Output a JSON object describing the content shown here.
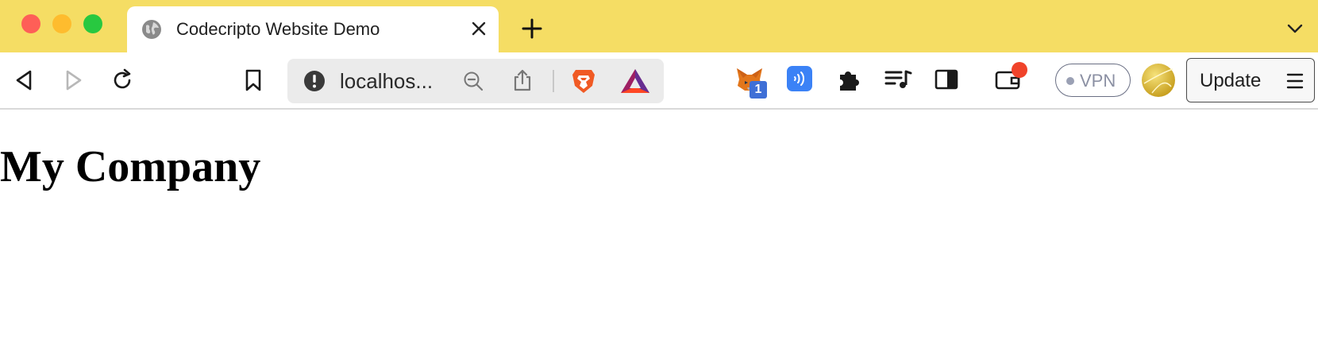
{
  "window": {
    "tab_title": "Codecripto Website Demo",
    "icons": {
      "close": "red-close-dot",
      "minimize": "yellow-minimize-dot",
      "maximize": "green-maximize-dot"
    },
    "accent_color": "#f5dd64"
  },
  "toolbar": {
    "url": "localhos...",
    "extensions": {
      "metamask_badge": "1"
    },
    "vpn_label": "VPN",
    "update_label": "Update"
  },
  "page": {
    "heading": "My Company"
  }
}
